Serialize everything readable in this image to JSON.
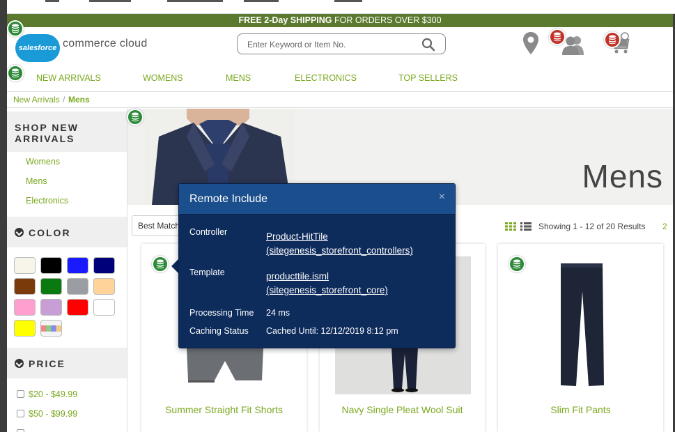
{
  "promo": {
    "bold": "FREE 2-Day SHIPPING",
    "rest": " FOR ORDERS OVER $300"
  },
  "logo": {
    "cloud_text": "salesforce",
    "text": "commerce cloud"
  },
  "search": {
    "placeholder": "Enter Keyword or Item No."
  },
  "nav": [
    "NEW ARRIVALS",
    "WOMENS",
    "MENS",
    "ELECTRONICS",
    "TOP SELLERS"
  ],
  "breadcrumb": {
    "first": "New Arrivals",
    "separator": "/",
    "current": "Mens"
  },
  "sidebar": {
    "shop_title_1": "SHOP NEW",
    "shop_title_2": "ARRIVALS",
    "categories": [
      "Womens",
      "Mens",
      "Electronics"
    ],
    "color_title": "COLOR",
    "swatches": [
      "#f7f5ea",
      "#000000",
      "#1a1aff",
      "#00007a",
      "#7a3a0a",
      "#0a7a10",
      "#9a9ea3",
      "#ffd39a",
      "#ff9fd0",
      "#c89ed6",
      "#ff0000",
      "#ffffff",
      "#ffff00",
      "multi"
    ],
    "price_title": "PRICE",
    "prices": [
      "$20 - $49.99",
      "$50 - $99.99"
    ]
  },
  "banner": {
    "title": "Mens"
  },
  "sort": {
    "selected": "Best Match"
  },
  "results": {
    "text": "Showing 1 - 12 of 20 Results",
    "next_page": "2"
  },
  "products": [
    "Summer Straight Fit Shorts",
    "Navy Single Pleat Wool Suit",
    "Slim Fit Pants"
  ],
  "popover": {
    "title": "Remote Include",
    "close": "×",
    "controller_label": "Controller",
    "controller_line1": "Product-HitTile",
    "controller_line2": "(sitegenesis_storefront_controllers)",
    "template_label": "Template",
    "template_line1": "producttile.isml",
    "template_line2": "(sitegenesis_storefront_core)",
    "processing_label": "Processing Time",
    "processing_value": "24 ms",
    "caching_label": "Caching Status",
    "caching_value": "Cached Until: 12/12/2019 8:12 pm"
  },
  "colors": {
    "accent": "#7aa81f",
    "promo_bg": "#5b7a2e",
    "popover_bg": "#0d2b5b",
    "popover_header": "#1b4e8c",
    "db_badge_green": "#2e8b3a",
    "db_badge_red": "#c0332b"
  }
}
